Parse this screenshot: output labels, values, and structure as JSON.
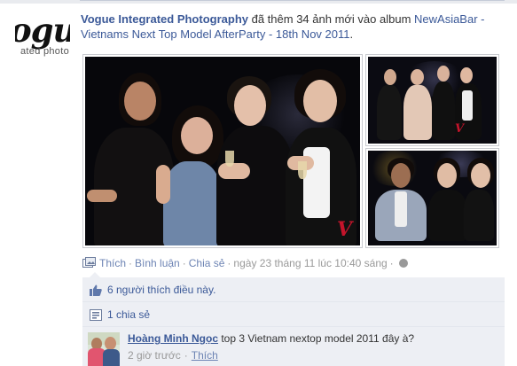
{
  "page": {
    "logo_big": "ogu",
    "logo_small": "ated photo"
  },
  "story": {
    "actor": "Vogue Integrated Photography",
    "action": " đã thêm 34 ảnh mới vào album ",
    "album": "NewAsiaBar - Vietnams Next Top Model AfterParty - 18th Nov 2011",
    "end": "."
  },
  "photos": {
    "p1_mark": "V",
    "p2_mark": "V"
  },
  "actions": {
    "like": "Thích",
    "comment": "Bình luận",
    "share": "Chia sẻ",
    "timestamp": "ngày 23 tháng 11 lúc 10:40 sáng",
    "sep": "·"
  },
  "ufi": {
    "likes_text": "6 người thích điều này.",
    "shares_text": "1 chia sẻ"
  },
  "comment": {
    "author": "Hoàng Minh Ngọc",
    "text": " top 3 Vietnam nextop model 2011 đây à?",
    "time": "2 giờ trước",
    "like": "Thích"
  },
  "colors": {
    "link": "#3b5998",
    "muted": "#999999",
    "ufi_bg": "#edeff4",
    "accent_red": "#c4142b"
  },
  "icons": [
    "photo-album-icon",
    "thumbs-up-icon",
    "share-icon",
    "globe-icon"
  ]
}
